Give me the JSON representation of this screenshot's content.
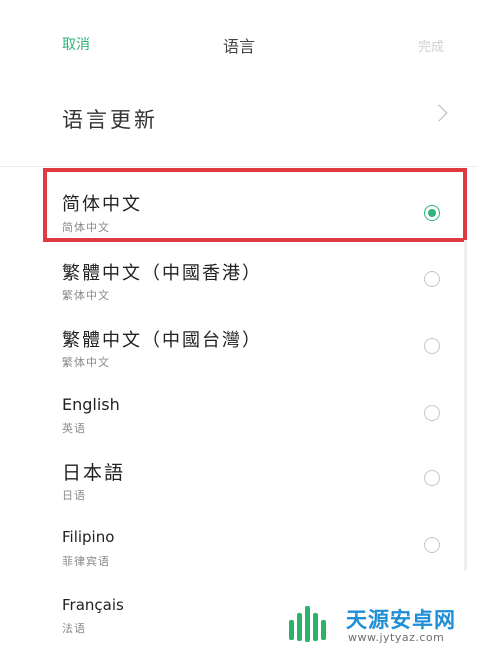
{
  "header": {
    "cancel_label": "取消",
    "title": "语言",
    "done_label": "完成"
  },
  "update_row": {
    "label": "语言更新"
  },
  "languages": [
    {
      "name": "简体中文",
      "sub": "简体中文",
      "selected": true
    },
    {
      "name": "繁體中文（中國香港）",
      "sub": "繁体中文",
      "selected": false
    },
    {
      "name": "繁體中文（中國台灣）",
      "sub": "繁体中文",
      "selected": false
    },
    {
      "name": "English",
      "sub": "英语",
      "selected": false
    },
    {
      "name": "日本語",
      "sub": "日语",
      "selected": false
    },
    {
      "name": "Filipino",
      "sub": "菲律宾语",
      "selected": false
    },
    {
      "name": "Français",
      "sub": "法语",
      "selected": false
    }
  ],
  "colors": {
    "accent": "#2fb37a",
    "highlight": "#e0393e",
    "watermark": "#1e8fd6"
  },
  "watermark": {
    "name": "天源安卓网",
    "url": "www.jytyaz.com"
  }
}
